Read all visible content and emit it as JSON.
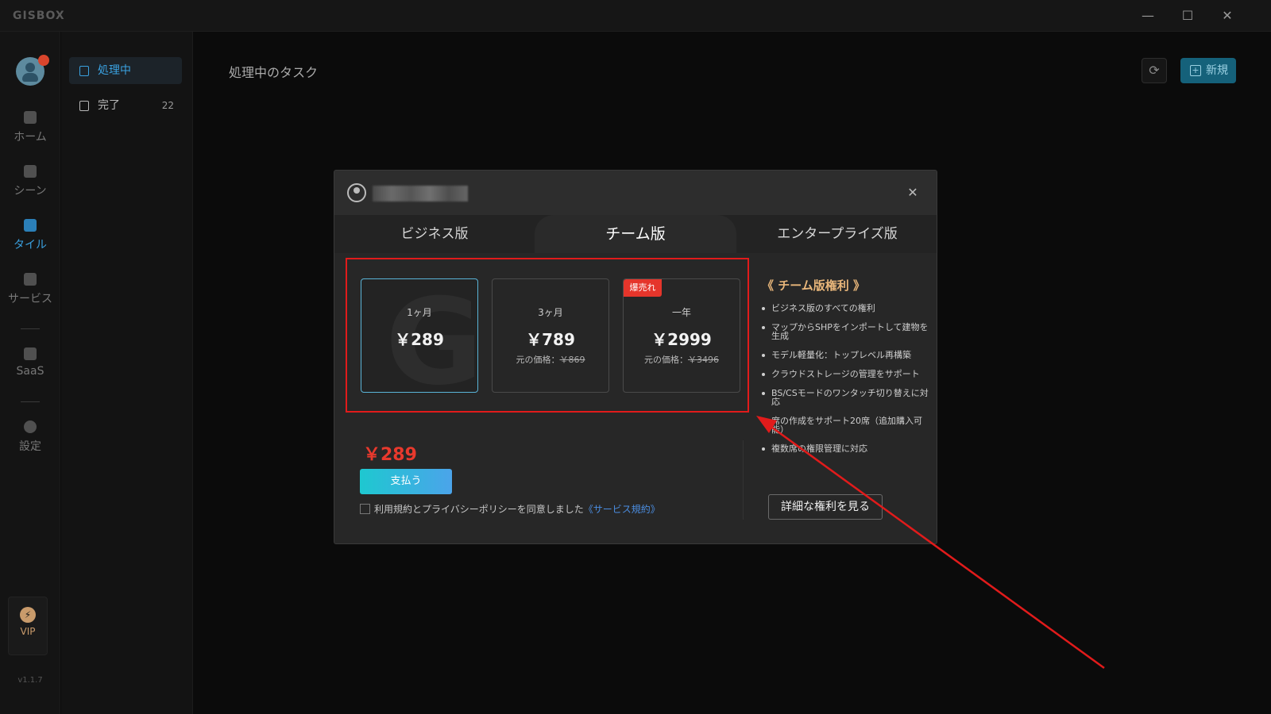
{
  "app": {
    "logo": "GISBOX"
  },
  "window": {
    "minimize": "—",
    "maximize": "☐",
    "close": "✕"
  },
  "sidebar": {
    "items": [
      {
        "label": "ホーム",
        "icon": "home-icon"
      },
      {
        "label": "シーン",
        "icon": "scene-icon"
      },
      {
        "label": "タイル",
        "icon": "tile-icon",
        "active": true
      },
      {
        "label": "サービス",
        "icon": "service-icon"
      },
      {
        "label": "SaaS",
        "icon": "saas-icon"
      },
      {
        "label": "設定",
        "icon": "settings-icon"
      }
    ],
    "vip_label": "VIP",
    "vip_icon": "⚡",
    "version": "v1.1.7"
  },
  "subpanel": {
    "items": [
      {
        "label": "処理中",
        "count": ""
      },
      {
        "label": "完了",
        "count": "22"
      }
    ]
  },
  "main": {
    "title": "処理中のタスク",
    "refresh_icon": "⟳",
    "new_icon": "+",
    "new_label": "新規"
  },
  "modal": {
    "close_icon": "✕",
    "tabs": [
      {
        "label": "ビジネス版"
      },
      {
        "label": "チーム版",
        "active": true
      },
      {
        "label": "エンタープライズ版"
      }
    ],
    "plans": [
      {
        "period": "1ヶ月",
        "price": "￥289",
        "orig_label": "",
        "orig_price": ""
      },
      {
        "period": "3ヶ月",
        "price": "￥789",
        "orig_label": "元の価格：",
        "orig_price": "￥869"
      },
      {
        "period": "一年",
        "price": "￥2999",
        "orig_label": "元の価格：",
        "orig_price": "￥3496",
        "badge": "爆売れ"
      }
    ],
    "watermark": "G",
    "total_price": "￥289",
    "pay_label": "支払う",
    "agree_text": "利用規約とプライバシーポリシーを同意しました",
    "agree_link": "《サービス規約》",
    "benefits_title": "《 チーム版権利 》",
    "benefits": [
      "ビジネス版のすべての権利",
      "マップからSHPをインポートして建物を生成",
      "モデル軽量化：トップレベル再構築",
      "クラウドストレージの管理をサポート",
      "BS/CSモードのワンタッチ切り替えに対応",
      "席の作成をサポート20席（追加購入可能）",
      "複数席の権限管理に対応"
    ],
    "detail_label": "詳細な権利を見る"
  },
  "colors": {
    "accent": "#3aa1e0",
    "price_red": "#e8392d",
    "highlight_red": "#e11b1b",
    "gold": "#e8b67a"
  }
}
